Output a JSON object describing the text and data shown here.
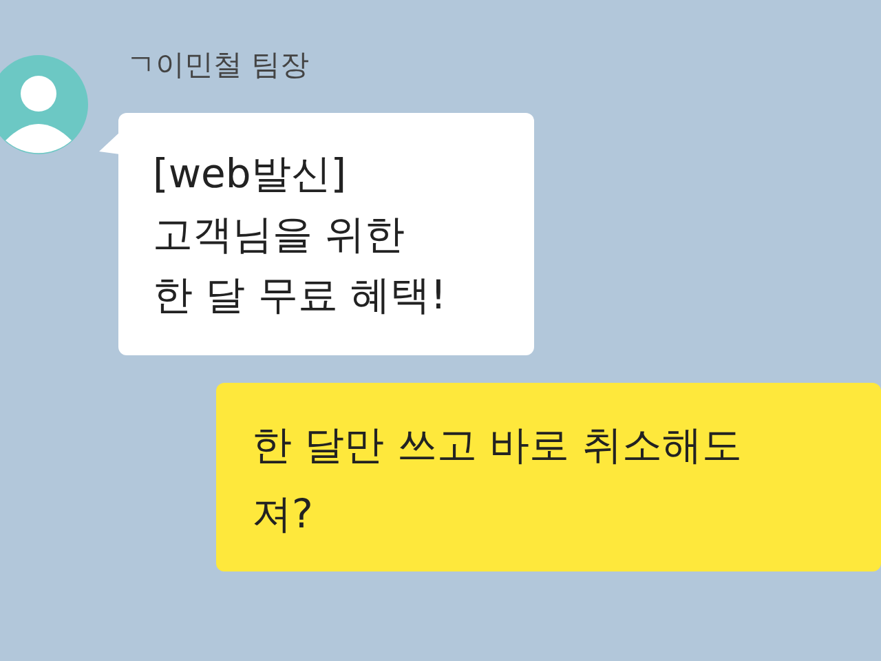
{
  "messages": [
    {
      "kind": "received",
      "sender": "ㄱ이민철 팀장",
      "lines": [
        "[web발신]",
        "고객님을 위한",
        "한 달 무료 혜택!"
      ]
    },
    {
      "kind": "sent",
      "lines": [
        "한 달만 쓰고 바로 취소해도",
        "져?"
      ]
    }
  ]
}
